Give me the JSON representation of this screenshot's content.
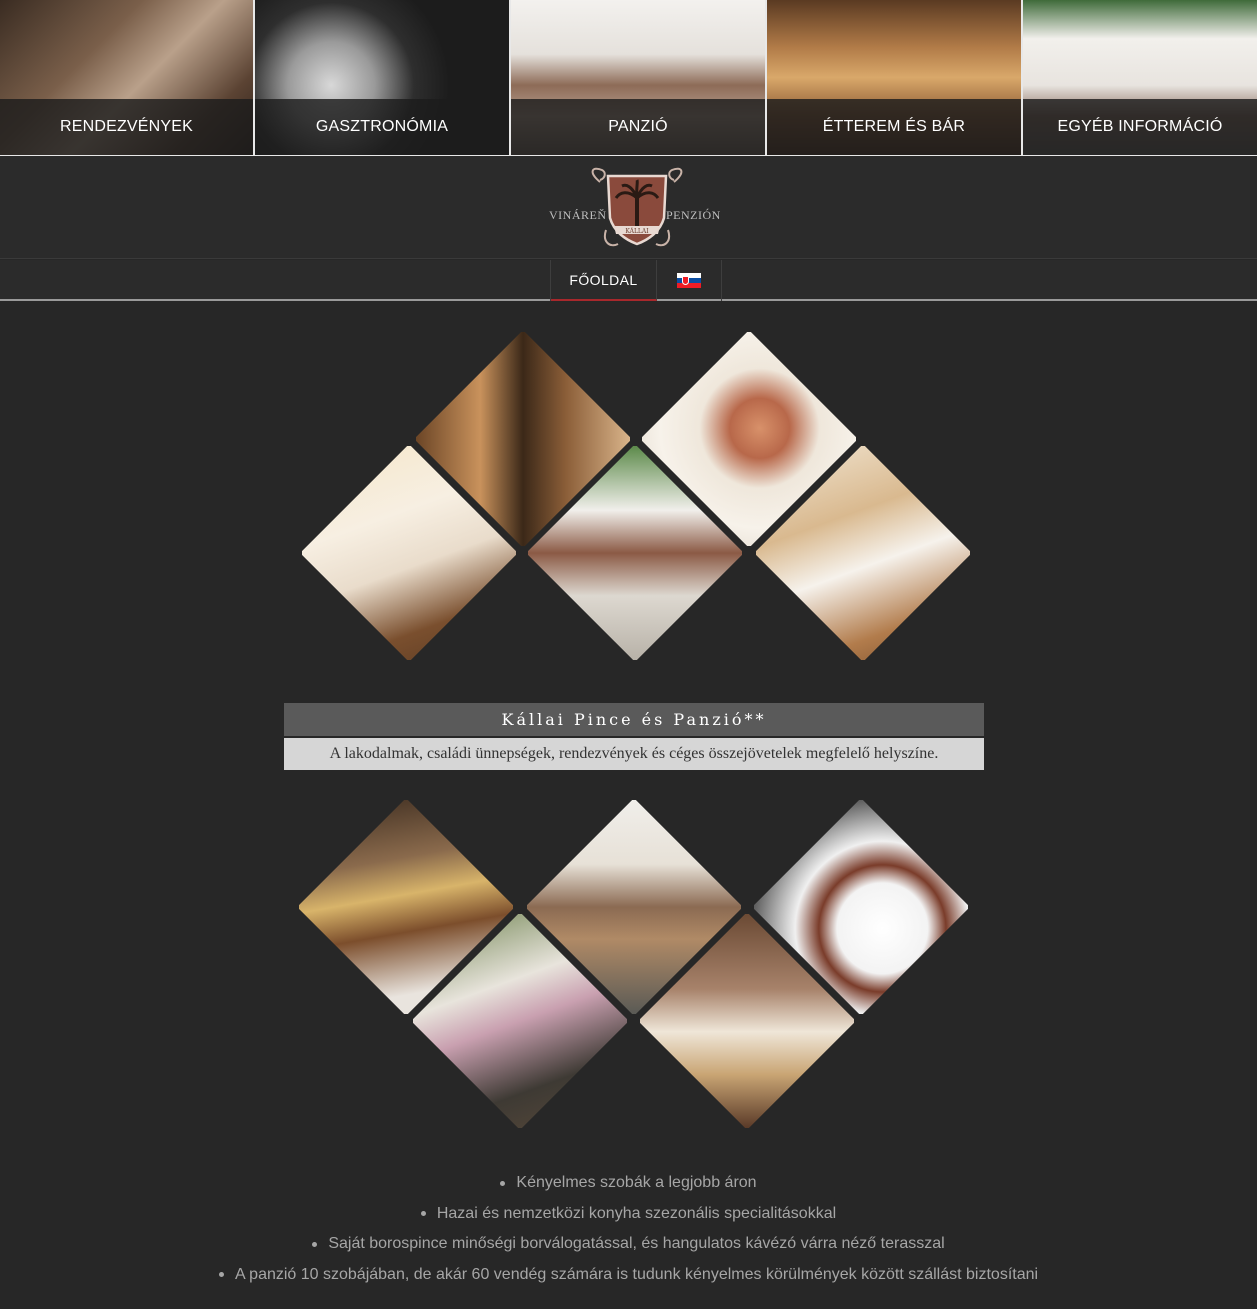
{
  "tiles": [
    {
      "label": "RENDEZVÉNYEK"
    },
    {
      "label": "GASZTRONÓMIA"
    },
    {
      "label": "PANZIÓ"
    },
    {
      "label": "ÉTTEREM ÉS BÁR"
    },
    {
      "label": "EGYÉB INFORMÁCIÓ"
    }
  ],
  "logo": {
    "left_text": "VINÁREŇ",
    "right_text": "PENZIÓN",
    "ribbon_text": "KÁLLAI"
  },
  "nav": {
    "home_label": "FŐOLDAL",
    "language_flag": "slovak-flag-icon"
  },
  "intro": {
    "title": "Kállai Pince és Panzió**",
    "subtitle": "A lakodalmak, családi ünnepségek, rendezvények és céges összejövetelek megfelelő helyszíne."
  },
  "features": [
    "Kényelmes szobák a legjobb áron",
    "Hazai és nemzetközi konyha szezonális specialitásokkal",
    "Saját borospince minőségi borválogatással, és hangulatos kávézó várra néző terasszal",
    "A panzió 10 szobájában, de akár 60 vendég számára is tudunk kényelmes körülmények között szállást biztosítani"
  ],
  "colors": {
    "background": "#272727",
    "accent": "#a8282c",
    "caption_bar": "#1c1c1c"
  }
}
